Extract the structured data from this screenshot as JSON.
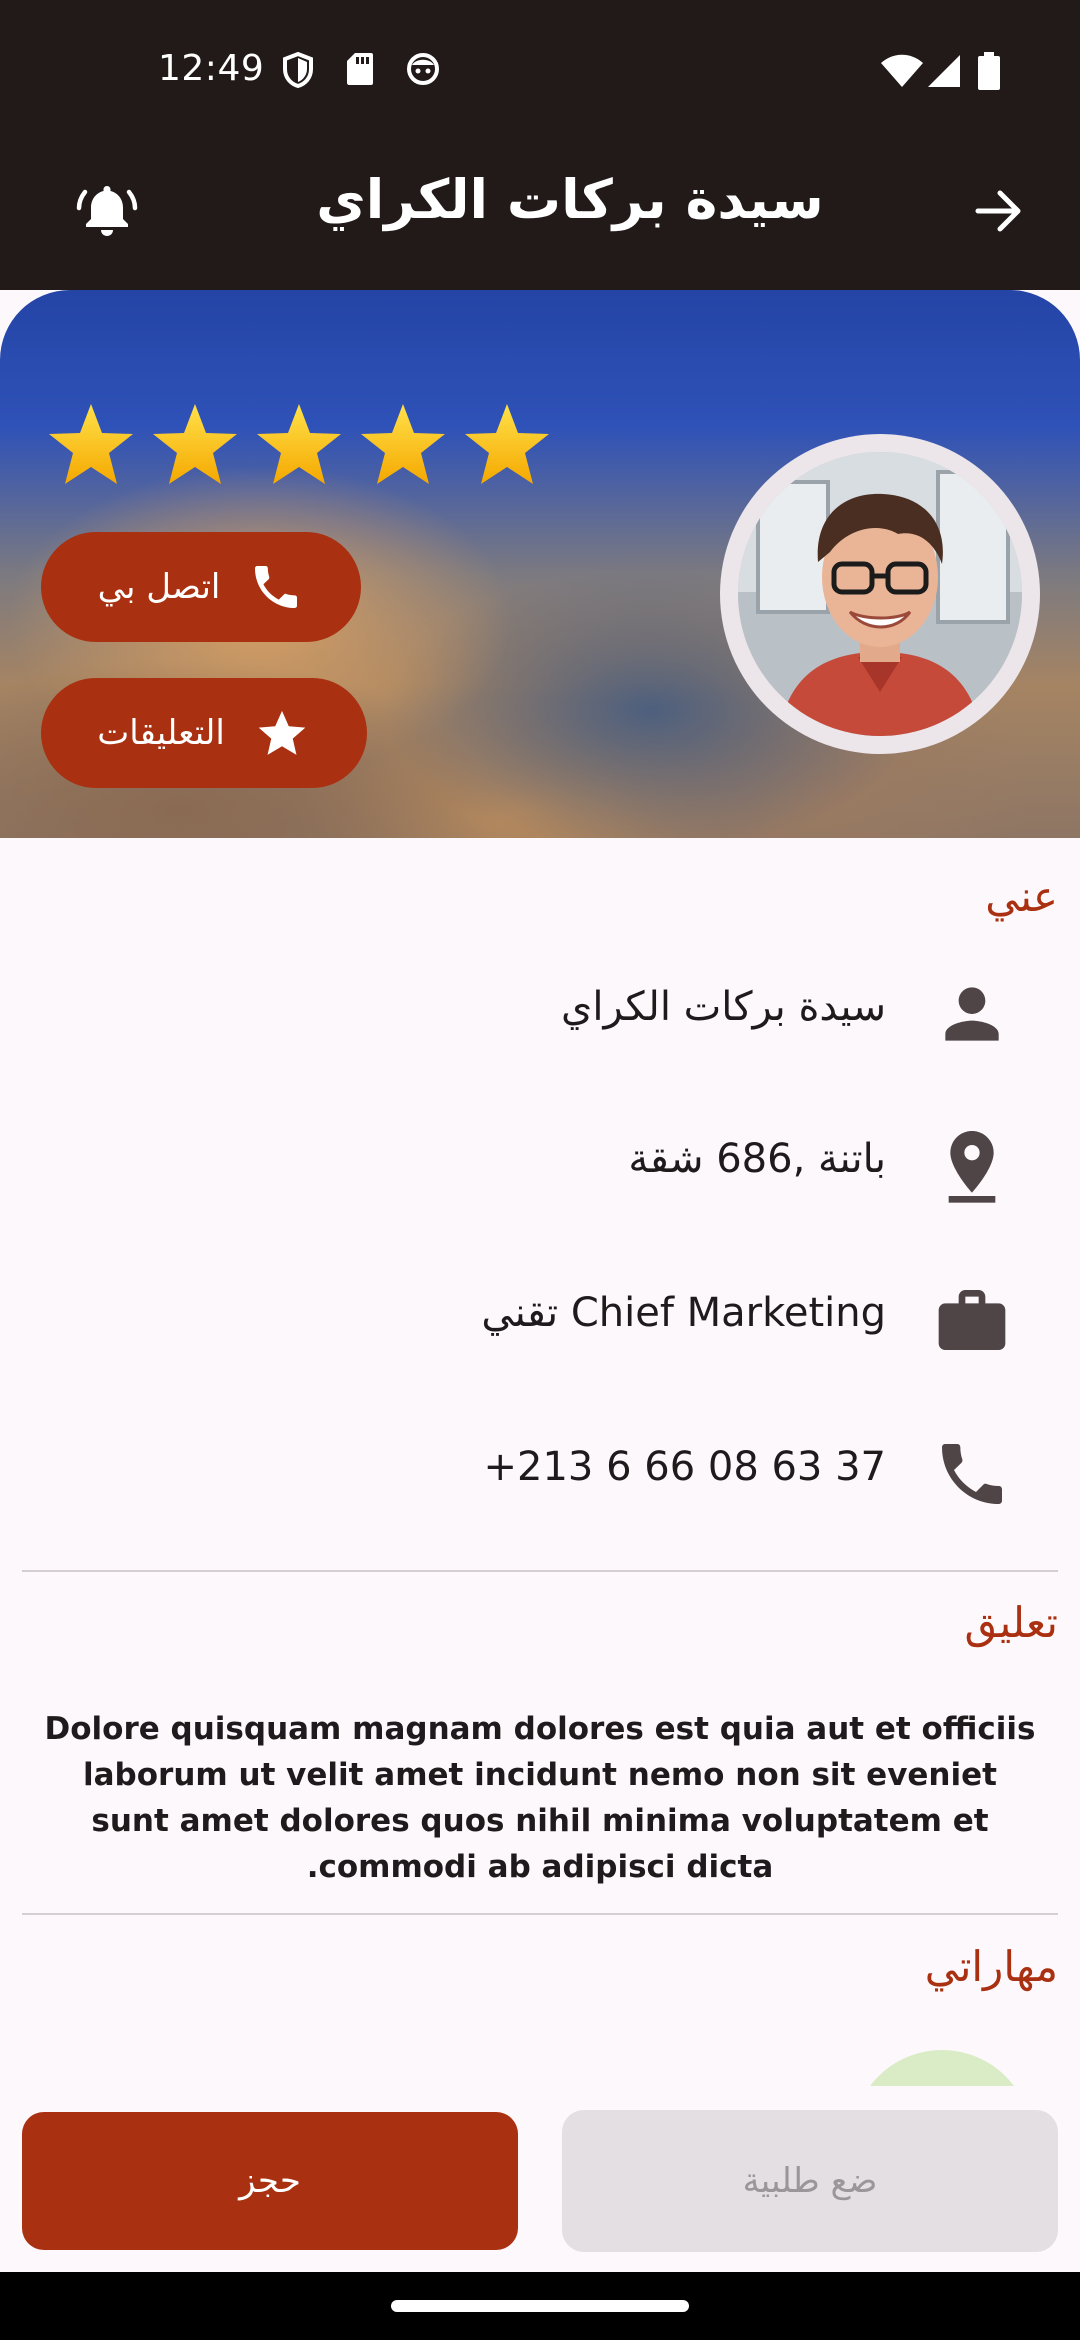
{
  "status_bar": {
    "time": "12:49",
    "left_icons": [
      "shield-icon",
      "sd-card-icon",
      "face-icon"
    ],
    "right_icons": [
      "wifi-icon",
      "signal-icon",
      "battery-icon"
    ]
  },
  "app_bar": {
    "title": "سيدة بركات الكراي",
    "left_icon": "bell-ringing-icon",
    "right_icon": "arrow-forward-icon"
  },
  "hero": {
    "rating": 5,
    "max_rating": 5,
    "call_button_label": "اتصل بي",
    "reviews_button_label": "التعليقات"
  },
  "about": {
    "title": "عني",
    "name": "سيدة بركات الكراي",
    "address": "باتنة ,686 شقة",
    "job": "Chief Marketing تقني",
    "phone": "+213 6 66 08 63 37"
  },
  "comment": {
    "title": "تعليق",
    "text": "Dolore quisquam magnam dolores est quia aut et officiis laborum ut velit amet incidunt nemo non sit eveniet sunt amet dolores quos nihil minima voluptatem et commodi ab adipisci dicta."
  },
  "skills": {
    "title": "مهاراتي"
  },
  "actions": {
    "book_label": "حجز",
    "order_label": "ضع طلبية"
  },
  "colors": {
    "accent": "#a93010",
    "dark_bar": "#211a18",
    "background": "#fdf8fb",
    "disabled_button": "#e3dfe2"
  }
}
